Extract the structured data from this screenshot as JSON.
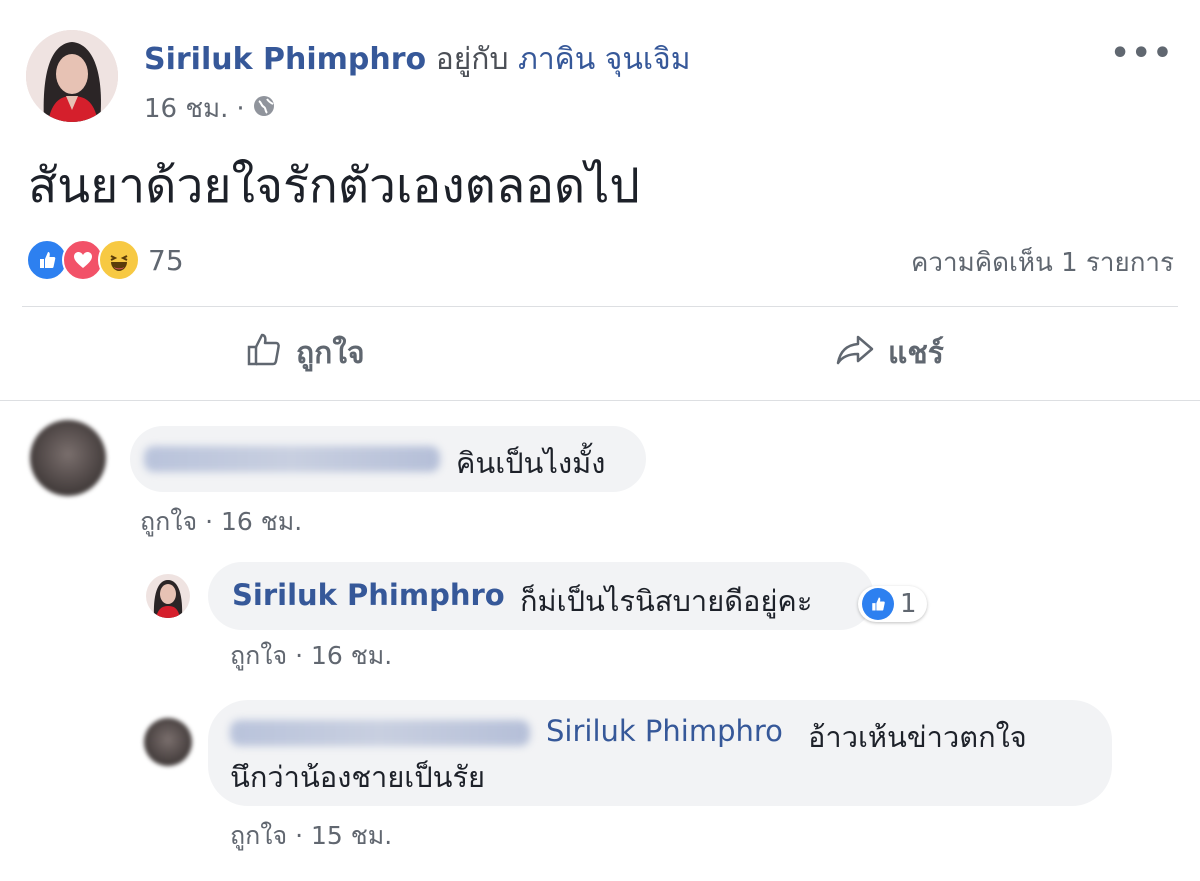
{
  "post": {
    "author": "Siriluk Phimphro",
    "with_text": "อยู่กับ",
    "tagged": "ภาคิน จุนเจิม",
    "time": "16 ชม.",
    "audience_icon": "globe-icon",
    "more_label": "•••",
    "text": "สันยาด้วยใจรักตัวเองตลอดไป",
    "reactions": {
      "icons": [
        "like-icon",
        "love-icon",
        "haha-icon"
      ],
      "count": "75"
    },
    "comments_count": "ความคิดเห็น 1 รายการ",
    "actions": {
      "like": "ถูกใจ",
      "share": "แชร์"
    }
  },
  "comments": [
    {
      "text": "คินเป็นไงมั้ง",
      "like": "ถูกใจ",
      "time": "16 ชม."
    },
    {
      "author": "Siriluk Phimphro",
      "text": "ก็ม่เป็นไรนิสบายดีอยู่คะ",
      "like": "ถูกใจ",
      "time": "16 ชม.",
      "reaction_count": "1"
    },
    {
      "tagged": "Siriluk Phimphro",
      "text_line1": "อ้าวเห้นข่าวตกใจ",
      "text_line2": "นึกว่าน้องชายเป็นรัย",
      "like": "ถูกใจ",
      "time": "15 ชม."
    }
  ],
  "colors": {
    "link": "#365899",
    "secondary_text": "#616770",
    "bubble": "#f2f3f5",
    "like_blue": "#2d80f0",
    "love_red": "#f25268",
    "haha_yellow": "#f7c943"
  }
}
